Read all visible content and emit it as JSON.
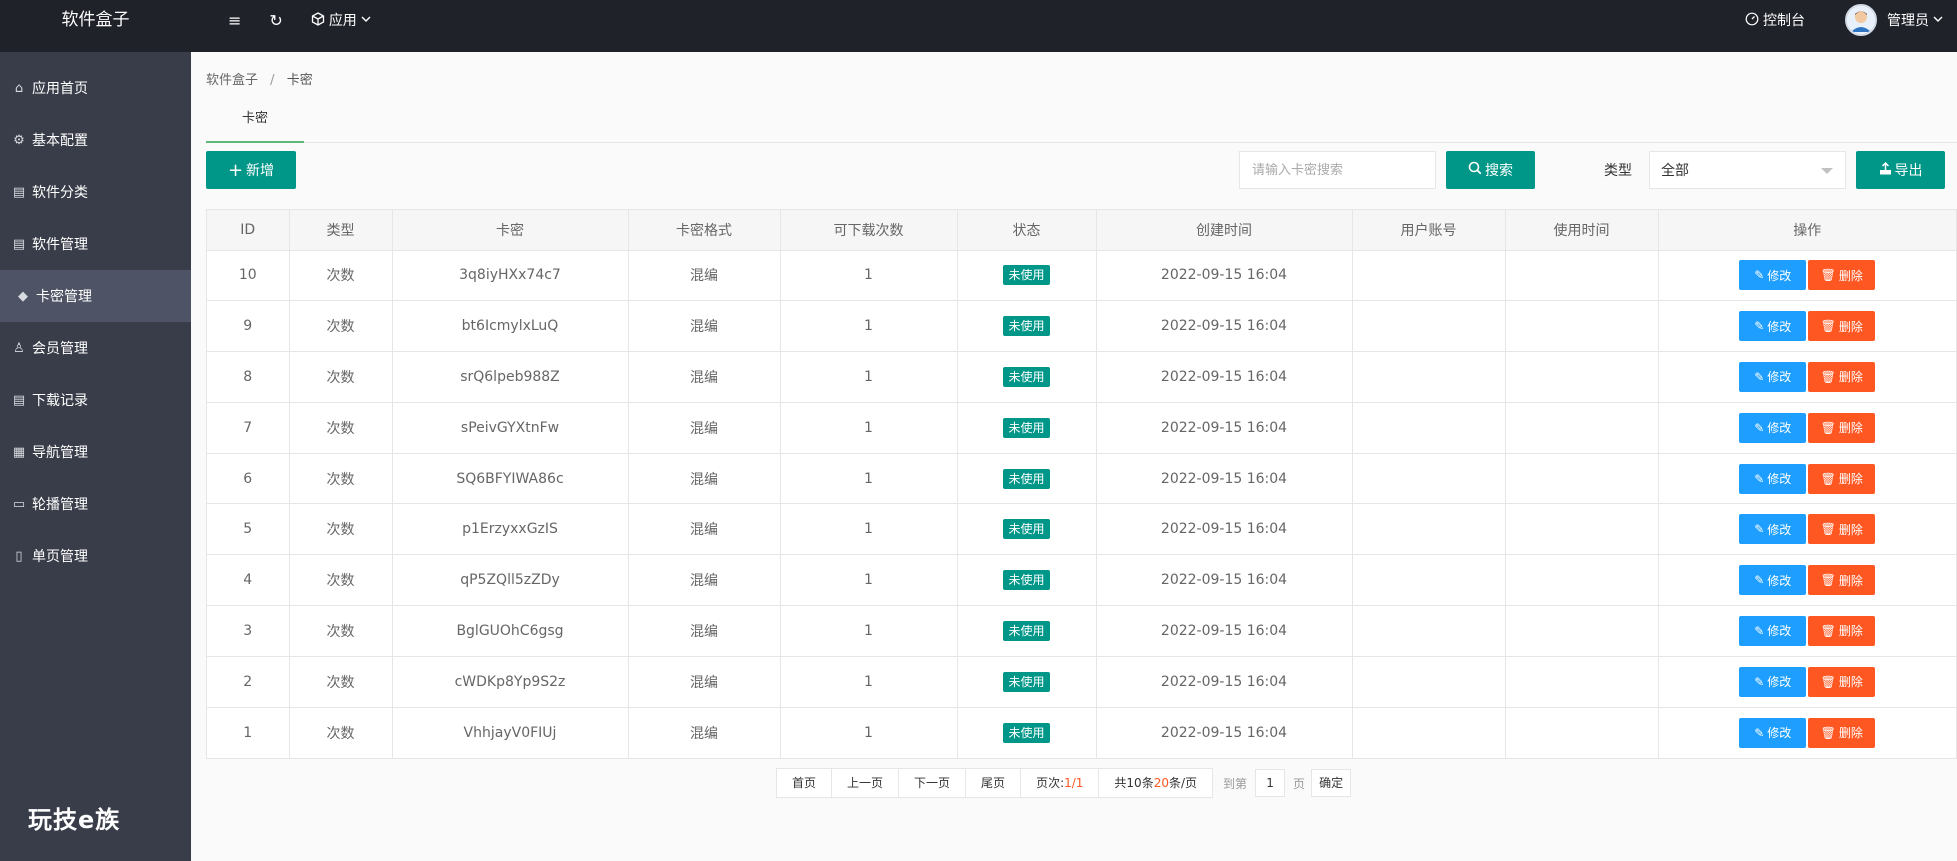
{
  "header": {
    "logo": "软件盒子",
    "menu_icon": "≡",
    "refresh_icon": "↻",
    "app_menu": "应用",
    "console": "控制台",
    "user": "管理员"
  },
  "sidebar": {
    "items": [
      {
        "label": "应用首页",
        "icon": "⌂"
      },
      {
        "label": "基本配置",
        "icon": "⚙"
      },
      {
        "label": "软件分类",
        "icon": "▤"
      },
      {
        "label": "软件管理",
        "icon": "▤"
      },
      {
        "label": "卡密管理",
        "icon": "◆",
        "active": true
      },
      {
        "label": "会员管理",
        "icon": "♙"
      },
      {
        "label": "下载记录",
        "icon": "▤"
      },
      {
        "label": "导航管理",
        "icon": "▦"
      },
      {
        "label": "轮播管理",
        "icon": "▭"
      },
      {
        "label": "单页管理",
        "icon": "▯"
      }
    ],
    "brand": "玩技e族"
  },
  "breadcrumb": {
    "root": "软件盒子",
    "sep": "/",
    "current": "卡密"
  },
  "tab": "卡密",
  "toolbar": {
    "add": "新增",
    "search_placeholder": "请输入卡密搜索",
    "search": "搜索",
    "type_label": "类型",
    "type_value": "全部",
    "export": "导出"
  },
  "table": {
    "headers": [
      "ID",
      "类型",
      "卡密",
      "卡密格式",
      "可下载次数",
      "状态",
      "创建时间",
      "用户账号",
      "使用时间",
      "操作"
    ],
    "edit_label": "修改",
    "delete_label": "删除",
    "rows": [
      {
        "id": "10",
        "type": "次数",
        "code": "3q8iyHXx74c7",
        "format": "混编",
        "count": "1",
        "status": "未使用",
        "created": "2022-09-15 16:04",
        "user": "",
        "used": ""
      },
      {
        "id": "9",
        "type": "次数",
        "code": "bt6IcmylxLuQ",
        "format": "混编",
        "count": "1",
        "status": "未使用",
        "created": "2022-09-15 16:04",
        "user": "",
        "used": ""
      },
      {
        "id": "8",
        "type": "次数",
        "code": "srQ6lpeb988Z",
        "format": "混编",
        "count": "1",
        "status": "未使用",
        "created": "2022-09-15 16:04",
        "user": "",
        "used": ""
      },
      {
        "id": "7",
        "type": "次数",
        "code": "sPeivGYXtnFw",
        "format": "混编",
        "count": "1",
        "status": "未使用",
        "created": "2022-09-15 16:04",
        "user": "",
        "used": ""
      },
      {
        "id": "6",
        "type": "次数",
        "code": "SQ6BFYIWA86c",
        "format": "混编",
        "count": "1",
        "status": "未使用",
        "created": "2022-09-15 16:04",
        "user": "",
        "used": ""
      },
      {
        "id": "5",
        "type": "次数",
        "code": "p1ErzyxxGzIS",
        "format": "混编",
        "count": "1",
        "status": "未使用",
        "created": "2022-09-15 16:04",
        "user": "",
        "used": ""
      },
      {
        "id": "4",
        "type": "次数",
        "code": "qP5ZQll5zZDy",
        "format": "混编",
        "count": "1",
        "status": "未使用",
        "created": "2022-09-15 16:04",
        "user": "",
        "used": ""
      },
      {
        "id": "3",
        "type": "次数",
        "code": "BglGUOhC6gsg",
        "format": "混编",
        "count": "1",
        "status": "未使用",
        "created": "2022-09-15 16:04",
        "user": "",
        "used": ""
      },
      {
        "id": "2",
        "type": "次数",
        "code": "cWDKp8Yp9S2z",
        "format": "混编",
        "count": "1",
        "status": "未使用",
        "created": "2022-09-15 16:04",
        "user": "",
        "used": ""
      },
      {
        "id": "1",
        "type": "次数",
        "code": "VhhjayV0FIUj",
        "format": "混编",
        "count": "1",
        "status": "未使用",
        "created": "2022-09-15 16:04",
        "user": "",
        "used": ""
      }
    ]
  },
  "pager": {
    "first": "首页",
    "prev": "上一页",
    "next": "下一页",
    "last": "尾页",
    "page_prefix": "页次:",
    "page_value": "1/1",
    "total_prefix": "共10条",
    "per_page": "20",
    "per_page_suffix": "条/页",
    "goto": "到第",
    "goto_value": "1",
    "page_unit": "页",
    "confirm": "确定"
  },
  "colors": {
    "accent": "#009688",
    "edit": "#1e9fff",
    "delete": "#ff5722",
    "sidebar": "#393d49",
    "topbar": "#20222a"
  }
}
